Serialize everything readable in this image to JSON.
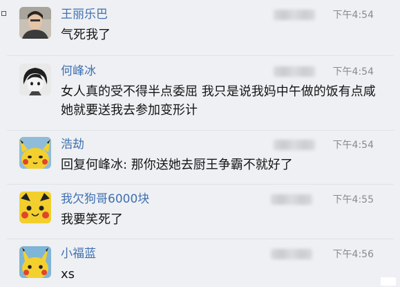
{
  "messages": [
    {
      "sender": "王丽乐巴",
      "time": "下午4:54",
      "text": "气死我了",
      "avatar": "photo-avatar"
    },
    {
      "sender": "何峰冰",
      "time": "下午4:54",
      "text": "女人真的受不得半点委屈 我只是说我妈中午做的饭有点咸 她就要送我去参加变形计",
      "avatar": "anime-avatar"
    },
    {
      "sender": "浩劫",
      "time": "下午4:54",
      "text": "回复何峰冰: 那你送她去厨王争霸不就好了",
      "avatar": "pikachu-avatar"
    },
    {
      "sender": "我欠狗哥6000块",
      "time": "下午4:55",
      "text": "我要笑死了",
      "avatar": "pikachu-avatar"
    },
    {
      "sender": "小福蓝",
      "time": "下午4:56",
      "text": "xs",
      "avatar": "pikachu-avatar"
    }
  ],
  "colors": {
    "sender": "#3f6fb0",
    "time": "#8a8a8a",
    "text": "#151515",
    "background": "#eef0f3"
  }
}
